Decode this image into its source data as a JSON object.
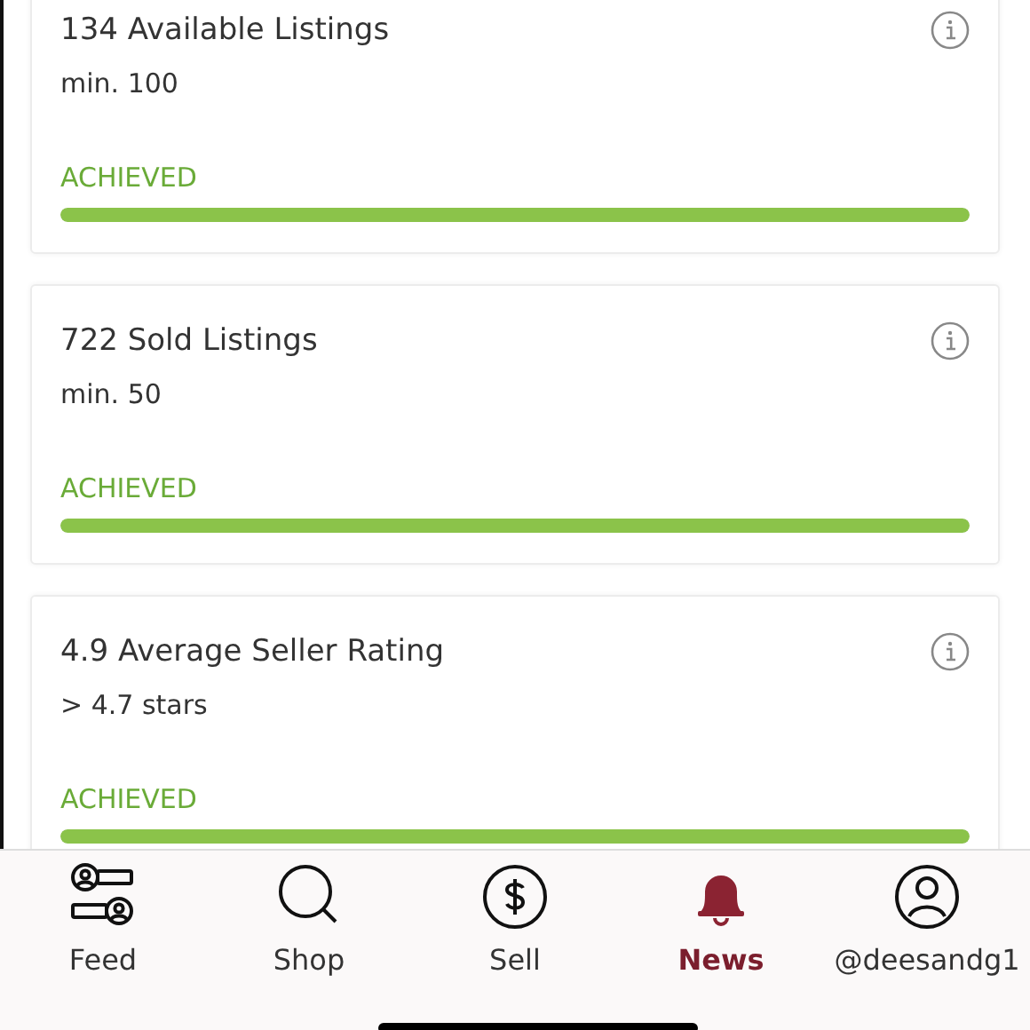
{
  "requirements": [
    {
      "title": "134 Available Listings",
      "minimum": "min. 100",
      "status": "ACHIEVED",
      "level": 1
    },
    {
      "title": "722 Sold Listings",
      "minimum": "min. 50",
      "status": "ACHIEVED",
      "level": 1
    },
    {
      "title": "4.9 Average Seller Rating",
      "minimum": "> 4.7 stars",
      "status": "ACHIEVED",
      "level": 1
    }
  ],
  "tab_bar": [
    {
      "label": "Feed",
      "selected": false
    },
    {
      "label": "Shop",
      "selected": false
    },
    {
      "label": "Sell",
      "selected": false
    },
    {
      "label": "News",
      "selected": true
    },
    {
      "label": "@deesandg1",
      "selected": false
    }
  ]
}
